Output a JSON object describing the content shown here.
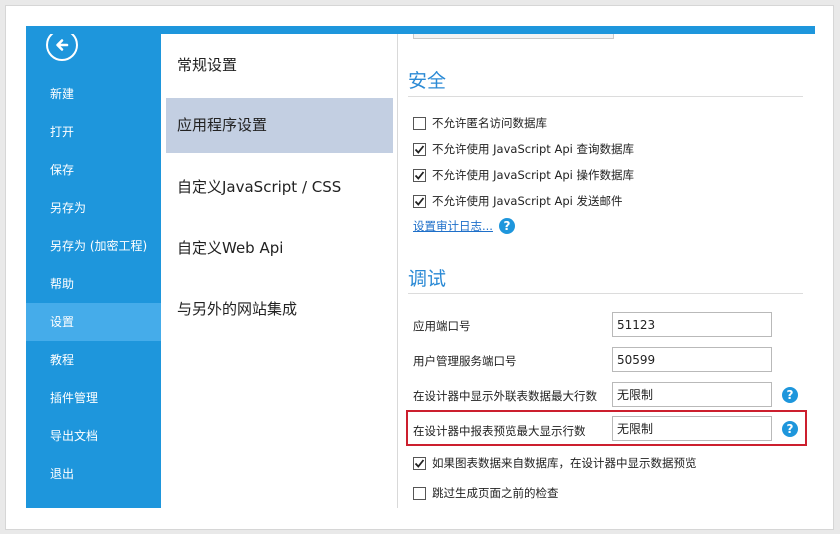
{
  "leftnav": {
    "back_icon": "arrow-left-circle-icon",
    "items": [
      {
        "label": "新建"
      },
      {
        "label": "打开"
      },
      {
        "label": "保存"
      },
      {
        "label": "另存为"
      },
      {
        "label": "另存为 (加密工程)"
      },
      {
        "label": "帮助"
      },
      {
        "label": "设置"
      },
      {
        "label": "教程"
      },
      {
        "label": "插件管理"
      },
      {
        "label": "导出文档"
      },
      {
        "label": "退出"
      }
    ],
    "active": "设置"
  },
  "settings_nav": {
    "items": [
      {
        "label": "常规设置"
      },
      {
        "label": "应用程序设置"
      },
      {
        "label": "自定义JavaScript / CSS"
      },
      {
        "label": "自定义Web Api"
      },
      {
        "label": "与另外的网站集成"
      }
    ],
    "active": "应用程序设置"
  },
  "security": {
    "title": "安全",
    "options": [
      {
        "label": "不允许匿名访问数据库",
        "checked": false
      },
      {
        "label": "不允许使用 JavaScript Api 查询数据库",
        "checked": true
      },
      {
        "label": "不允许使用 JavaScript Api 操作数据库",
        "checked": true
      },
      {
        "label": "不允许使用 JavaScript Api 发送邮件",
        "checked": true
      }
    ],
    "audit_link": "设置审计日志..."
  },
  "debug": {
    "title": "调试",
    "fields": [
      {
        "label": "应用端口号",
        "value": "51123"
      },
      {
        "label": "用户管理服务端口号",
        "value": "50599"
      },
      {
        "label": "在设计器中显示外联表数据最大行数",
        "value": "无限制"
      },
      {
        "label": "在设计器中报表预览最大显示行数",
        "value": "无限制"
      }
    ],
    "options": [
      {
        "label": "如果图表数据来自数据库，在设计器中显示数据预览",
        "checked": true
      },
      {
        "label": "跳过生成页面之前的检查",
        "checked": false
      }
    ]
  },
  "colors": {
    "accent": "#1e96dc",
    "nav_active": "#45acea",
    "settings_active": "#c3cfe2",
    "section_title": "#2b8ad5",
    "highlight": "#cc1f2e"
  }
}
